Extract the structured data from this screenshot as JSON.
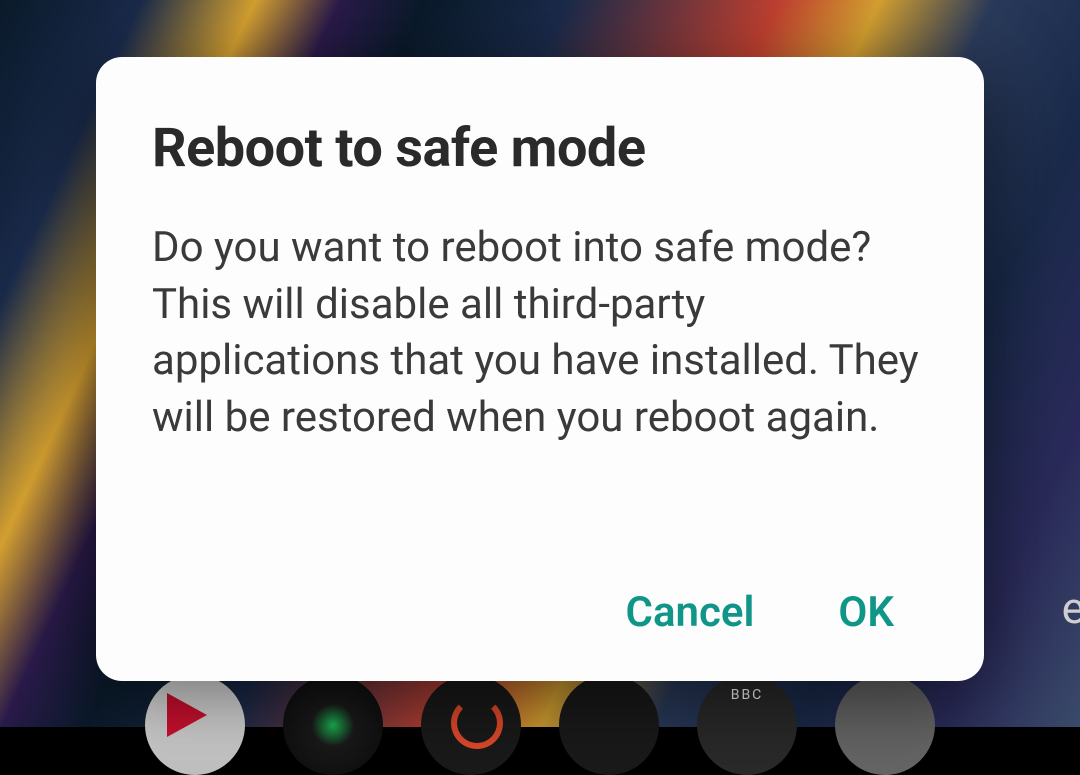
{
  "dialog": {
    "title": "Reboot to safe mode",
    "message": "Do you want to reboot into safe mode? This will disable all third-party applications that you have installed. They will be restored when you reboot again.",
    "cancel_label": "Cancel",
    "ok_label": "OK"
  },
  "background": {
    "partial_label": "e",
    "dock_bbc_label": "BBC"
  }
}
